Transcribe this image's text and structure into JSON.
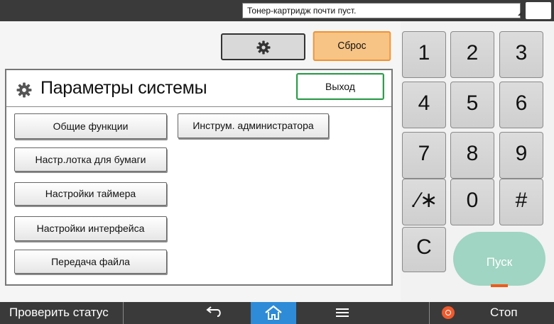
{
  "status_bar": {
    "message": "Тонер-картридж почти пуст."
  },
  "header": {
    "reset_label": "Сброс"
  },
  "panel": {
    "title": "Параметры системы",
    "exit_label": "Выход",
    "buttons": [
      "Общие функции",
      "Настр.лотка для бумаги",
      "Настройки таймера",
      "Настройки интерфейса",
      "Передача файла",
      "Инструм. администратора"
    ]
  },
  "keypad": {
    "keys": [
      "1",
      "2",
      "3",
      "4",
      "5",
      "6",
      "7",
      "8",
      "9",
      ".∕∗",
      "0",
      "#",
      "C"
    ],
    "start_label": "Пуск"
  },
  "bottom_bar": {
    "check_status_label": "Проверить статус",
    "stop_label": "Стоп"
  },
  "colors": {
    "reset_accent": "#f09233",
    "exit_accent": "#2aa04a",
    "home_accent": "#2e8bd8",
    "start_accent": "#9fd5c2",
    "stop_accent": "#ef5a2d"
  },
  "icons": [
    "moon-icon",
    "gear-icon",
    "back-icon",
    "home-icon",
    "menu-icon",
    "stop-icon"
  ]
}
